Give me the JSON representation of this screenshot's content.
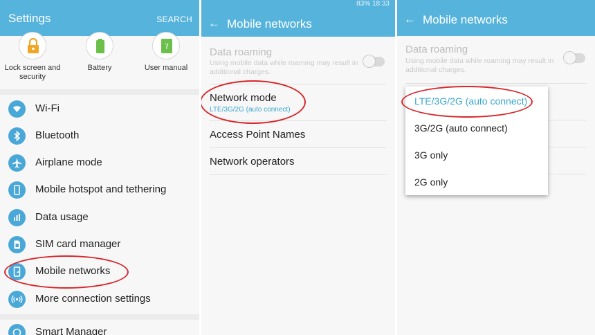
{
  "panel1": {
    "title": "Settings",
    "search_label": "SEARCH",
    "quick_icons": [
      {
        "label": "Lock screen and security",
        "icon": "lock-icon",
        "color": "#f2a626"
      },
      {
        "label": "Battery",
        "icon": "battery-icon",
        "color": "#6cbf4a"
      },
      {
        "label": "User manual",
        "icon": "book-icon",
        "color": "#6cbf4a"
      }
    ],
    "items": [
      {
        "label": "Wi-Fi",
        "icon": "wifi-icon"
      },
      {
        "label": "Bluetooth",
        "icon": "bluetooth-icon"
      },
      {
        "label": "Airplane mode",
        "icon": "airplane-icon"
      },
      {
        "label": "Mobile hotspot and tethering",
        "icon": "hotspot-icon"
      },
      {
        "label": "Data usage",
        "icon": "data-usage-icon"
      },
      {
        "label": "SIM card manager",
        "icon": "sim-card-icon"
      },
      {
        "label": "Mobile networks",
        "icon": "mobile-networks-icon",
        "highlighted": true
      },
      {
        "label": "More connection settings",
        "icon": "connection-icon"
      },
      {
        "label": "Smart Manager",
        "icon": "smart-manager-icon"
      }
    ]
  },
  "panel2": {
    "title": "Mobile networks",
    "status": "83% 18:33",
    "data_roaming": {
      "label": "Data roaming",
      "description": "Using mobile data while roaming may result in additional charges.",
      "enabled": false
    },
    "network_mode": {
      "label": "Network mode",
      "value": "LTE/3G/2G (auto connect)",
      "highlighted": true
    },
    "apn_label": "Access Point Names",
    "operators_label": "Network operators"
  },
  "panel3": {
    "title": "Mobile networks",
    "data_roaming": {
      "label": "Data roaming",
      "description": "Using mobile data while roaming may result in additional charges.",
      "enabled": false
    },
    "options": [
      {
        "label": "LTE/3G/2G (auto connect)",
        "selected": true
      },
      {
        "label": "3G/2G (auto connect)",
        "selected": false
      },
      {
        "label": "3G only",
        "selected": false
      },
      {
        "label": "2G only",
        "selected": false
      }
    ]
  },
  "colors": {
    "appbar": "#56b3dc",
    "accent": "#3ba7cf",
    "highlight_oval": "#d8262a"
  }
}
